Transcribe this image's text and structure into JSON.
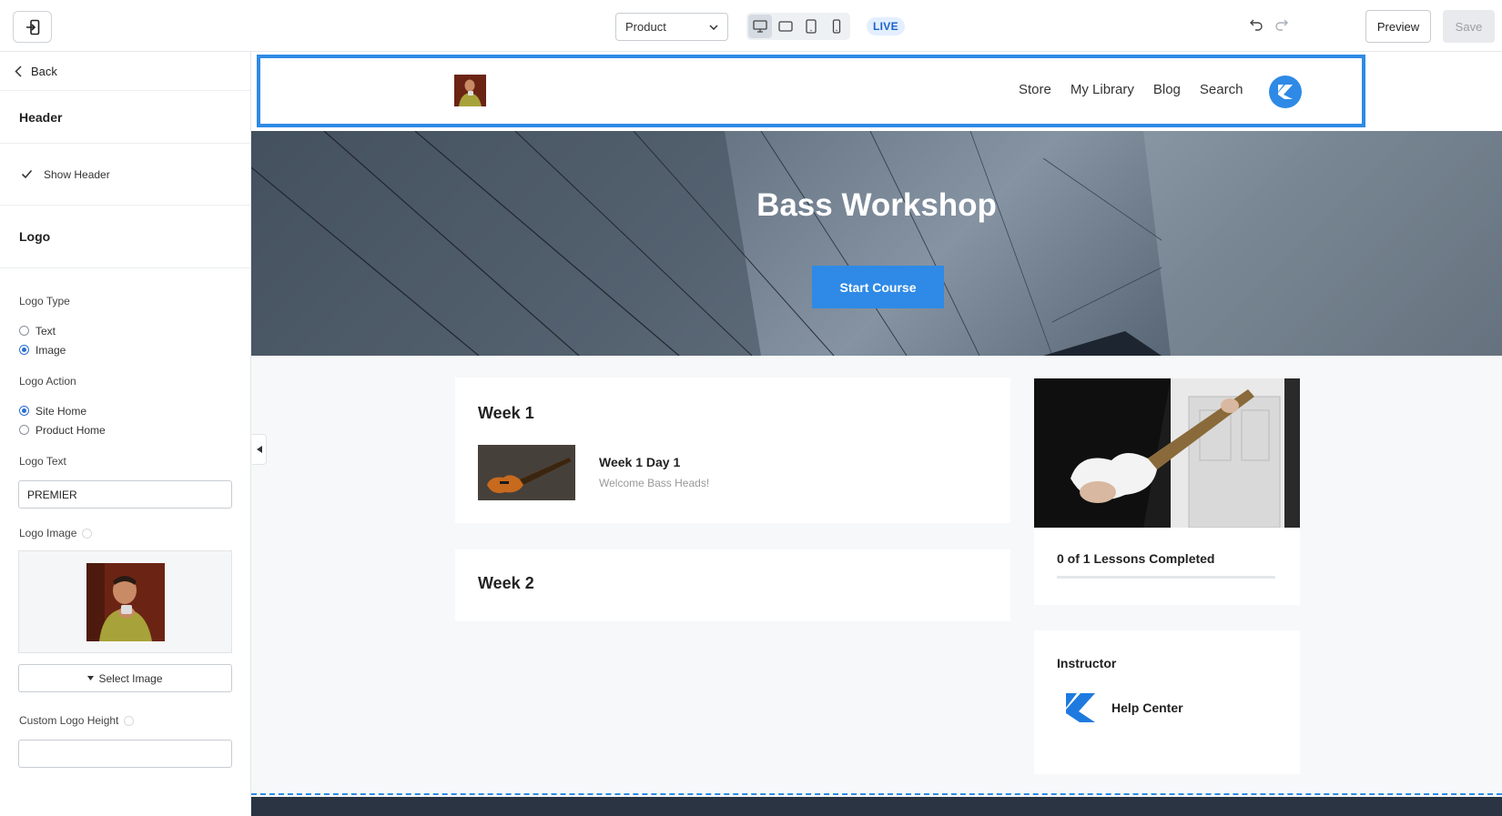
{
  "toolbar": {
    "page_select": "Product",
    "live_badge": "LIVE",
    "preview_label": "Preview",
    "save_label": "Save"
  },
  "sidebar": {
    "back_label": "Back",
    "header_section": "Header",
    "show_header_label": "Show Header",
    "logo_section": "Logo",
    "logo_type_label": "Logo Type",
    "logo_type_options": [
      "Text",
      "Image"
    ],
    "logo_action_label": "Logo Action",
    "logo_action_options": [
      "Site Home",
      "Product Home"
    ],
    "logo_text_label": "Logo Text",
    "logo_text_value": "PREMIER",
    "logo_image_label": "Logo Image",
    "select_image_label": "Select Image",
    "custom_logo_height_label": "Custom Logo Height",
    "custom_logo_height_value": ""
  },
  "site": {
    "nav": [
      "Store",
      "My Library",
      "Blog",
      "Search"
    ],
    "hero_title": "Bass Workshop",
    "hero_button": "Start Course",
    "weeks": [
      {
        "title": "Week 1",
        "lesson_title": "Week 1 Day 1",
        "lesson_sub": "Welcome Bass Heads!"
      },
      {
        "title": "Week 2"
      }
    ],
    "progress_text": "0 of 1 Lessons Completed",
    "progress_fraction": 0,
    "instructor_title": "Instructor",
    "instructor_name": "Help Center"
  },
  "colors": {
    "accent": "#2e8ae6",
    "footer": "#2a3442"
  }
}
